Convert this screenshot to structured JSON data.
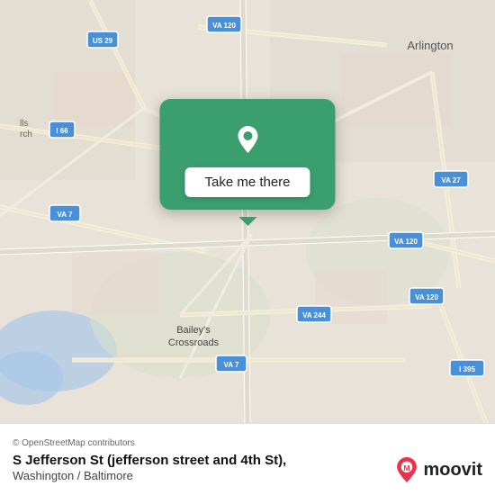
{
  "map": {
    "alt": "Map of S Jefferson St area, Washington/Baltimore"
  },
  "popup": {
    "button_label": "Take me there",
    "pin_icon": "location-pin"
  },
  "bottom_bar": {
    "attribution": "© OpenStreetMap contributors",
    "location_title": "S Jefferson St (jefferson street and 4th St),",
    "location_subtitle": "Washington / Baltimore",
    "logo_text": "moovit"
  },
  "road_labels": {
    "us29": "US 29",
    "va120_top": "VA 120",
    "va27": "VA 27",
    "i66": "I 66",
    "va7_left": "VA 7",
    "va120_mid": "VA 120",
    "va244": "VA 244",
    "va120_right": "VA 120",
    "va7_bottom": "VA 7",
    "i395": "I 395",
    "baileys": "Bailey's\nCrossroads",
    "arlington": "Arlington",
    "hills_church": "lls\nrch"
  }
}
